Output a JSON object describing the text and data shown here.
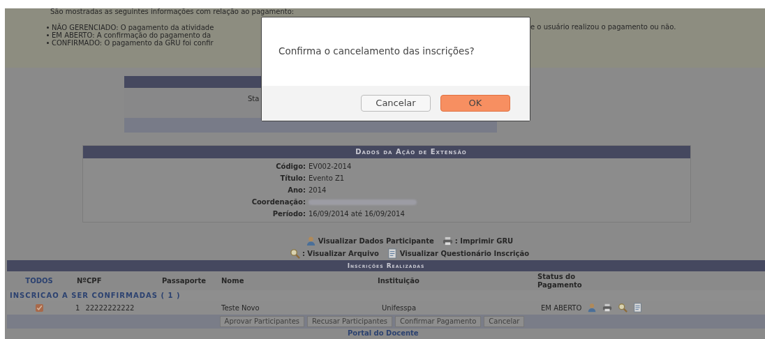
{
  "intro": {
    "text": "São mostradas as seguintes informações com relação ao pagamento:",
    "bullets": [
      {
        "left": "NÃO GERENCIADO: O pagamento da atividade",
        "right": "e o usuário realizou o pagamento ou não."
      },
      {
        "left": "EM ABERTO: A confirmação do pagamento da"
      },
      {
        "left": "CONFIRMADO: O pagamento da GRU foi confir"
      }
    ]
  },
  "status_box": {
    "label": "Sta"
  },
  "dialog": {
    "message": "Confirma o cancelamento das inscrições?",
    "buttons": [
      {
        "label": "Cancelar",
        "kind": "secondary"
      },
      {
        "label": "OK",
        "kind": "primary"
      }
    ]
  },
  "acao": {
    "title": "Dados da Ação de Extensão",
    "fields": [
      {
        "label": "Código:",
        "value": "EV002-2014"
      },
      {
        "label": "Título:",
        "value": "Evento Z1"
      },
      {
        "label": "Ano:",
        "value": "2014"
      },
      {
        "label": "Coordenação:",
        "redacted": true
      },
      {
        "label": "Período:",
        "value": "16/09/2014 até 16/09/2014"
      }
    ]
  },
  "legend": [
    [
      "Visualizar Dados Participante",
      ": Imprimir GRU"
    ],
    [
      ": Visualizar Arquivo",
      "Visualizar Questionário Inscrição"
    ]
  ],
  "table": {
    "title": "Inscrições Realizadas",
    "columns": [
      "TODOS",
      "NºCPF",
      "Passaporte",
      "Nome",
      "Instituição",
      "Status do Pagamento"
    ],
    "group": "INSCRICAO A SER CONFIRMADAS ( 1 )",
    "rows": [
      {
        "checked": true,
        "index": "1",
        "cpf": "22222222222",
        "nome": "Teste Novo",
        "instituicao": "Unifesspa",
        "status": "EM ABERTO"
      }
    ],
    "buttons": [
      "Aprovar Participantes",
      "Recusar Participantes",
      "Confirmar Pagamento",
      "Cancelar"
    ]
  },
  "footer_link": "Portal do Docente"
}
